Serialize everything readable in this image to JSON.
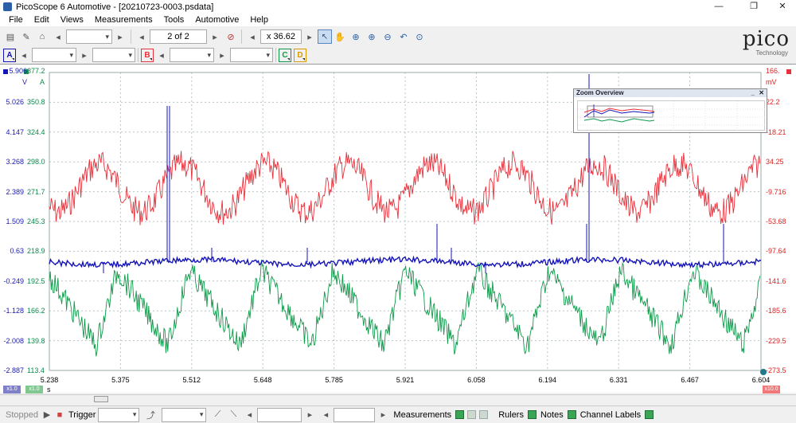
{
  "window": {
    "title": "PicoScope 6 Automotive - [20210723-0003.psdata]",
    "controls": [
      "—",
      "❐",
      "✕"
    ]
  },
  "menu": [
    "File",
    "Edit",
    "Views",
    "Measurements",
    "Tools",
    "Automotive",
    "Help"
  ],
  "toolbar": {
    "page_indicator": "2 of 2",
    "zoom_factor": "x 36.62"
  },
  "channels": {
    "a_label": "A",
    "b_label": "B",
    "c_label": "C",
    "d_label": "D",
    "colors": {
      "a": "#1414b8",
      "b": "#e8303a",
      "c": "#0f9a4a",
      "d": "#d89a00"
    }
  },
  "logo": {
    "name": "pico",
    "sub": "Technology"
  },
  "chart_data": {
    "type": "line",
    "x_axis": {
      "unit": "s",
      "range": [
        5.238,
        6.604
      ],
      "ticks": [
        "5.238",
        "5.375",
        "5.512",
        "5.648",
        "5.785",
        "5.921",
        "6.058",
        "6.194",
        "6.331",
        "6.467",
        "6.604"
      ]
    },
    "axis_v": {
      "unit": "V",
      "top": "5.906",
      "ticks": [
        "5.026",
        "4.147",
        "3.268",
        "2.389",
        "1.509",
        "0.63",
        "-0.249",
        "-1.128",
        "-2.008",
        "-2.887"
      ]
    },
    "axis_a": {
      "unit": "A",
      "top": "377.2",
      "ticks": [
        "350.8",
        "324.4",
        "298.0",
        "271.7",
        "245.3",
        "218.9",
        "192.5",
        "166.2",
        "139.8",
        "113.4"
      ]
    },
    "axis_mv": {
      "unit": "mV",
      "top": "166.",
      "ticks": [
        "22.2",
        "-18.21",
        "34.25",
        "-9.716",
        "-53.68",
        "-97.64",
        "-141.6",
        "-185.6",
        "-229.5",
        "-273.5"
      ]
    },
    "series": [
      {
        "color": "#e8303a",
        "type": "ripple"
      },
      {
        "color": "#0f9a4a",
        "type": "sawtooth"
      },
      {
        "color": "#1414b8",
        "type": "flat_with_spikes"
      }
    ],
    "scale_badges": {
      "a": "x1.0",
      "c": "x1.0",
      "b": "x10.0"
    }
  },
  "zoom_overview": {
    "title": "Zoom Overview",
    "minimize": "_",
    "close": "✕"
  },
  "statusbar": {
    "state": "Stopped",
    "trigger_label": "Trigger",
    "measurements_label": "Measurements",
    "rulers_label": "Rulers",
    "notes_label": "Notes",
    "channel_labels_label": "Channel Labels"
  }
}
